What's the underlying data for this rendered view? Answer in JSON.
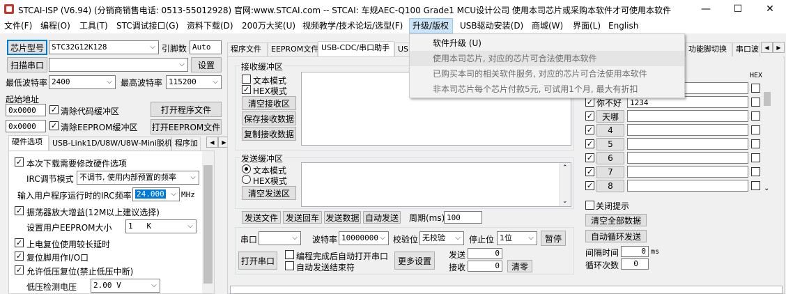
{
  "window": {
    "title": "STCAI-ISP (V6.94) (分销商销售电话: 0513-55012928) 官网:www.STCAI.com  -- STCAI: 车规AEC-Q100 Grade1 MCU设计公司 使用本司芯片或采购本软件才可使用本软件",
    "minimize": "—",
    "maximize": "☐",
    "close": "✕"
  },
  "menu": [
    "文件(F)",
    "编程(O)",
    "工具(T)",
    "STC调试接口(G)",
    "资料下载(D)",
    "200万大奖(U)",
    "视频教学/技术论坛/选型(F)",
    "升级/版权",
    "USB驱动安装(D)",
    "商城(W)",
    "界面(L)",
    "English"
  ],
  "dropdown": [
    "软件升级 (U)",
    "使用本司芯片, 对应的芯片可合法使用本软件",
    "已购买本司的相关软件服务, 对应的芯片可合法使用本软件",
    "非本司芯片每个芯片付款5元, 可试用1个月, 最大有折扣"
  ],
  "left": {
    "chip_type_btn": "芯片型号",
    "chip_model": "STC32G12K128",
    "pin_label": "引脚数",
    "pin_value": "Auto",
    "scan_port_btn": "扫描串口",
    "settings_btn": "设置",
    "min_baud_label": "最低波特率",
    "min_baud": "2400",
    "max_baud_label": "最高波特率",
    "max_baud": "115200",
    "start_addr_label": "起始地址",
    "addr1": "0x0000",
    "clear_code": "清除代码缓冲区",
    "open_prog_btn": "打开程序文件",
    "addr2": "0x0000",
    "clear_eeprom": "清除EEPROM缓冲区",
    "open_eeprom_btn": "打开EEPROM文件",
    "tabs": [
      "硬件选项",
      "USB-Link1D/U8W/U8W-Mini脱机",
      "程序加"
    ],
    "options": {
      "opt1": "本次下载需要修改硬件选项",
      "irc_mode_label": "IRC调节模式",
      "irc_mode": "不调节, 使用内部预置的频率",
      "irc_freq_label": "输入用户程序运行时的IRC频率",
      "irc_freq": "24.000",
      "mhz": "MHz",
      "opt2": "振荡器放大增益(12M以上建议选择)",
      "eeprom_size_label": "设置用户EEPROM大小",
      "eeprom_size": "1   K",
      "opt3": "上电复位使用较长延时",
      "opt4": "复位脚用作I/O口",
      "opt5": "允许低压复位(禁止低压中断)",
      "lv_label": "低压检测电压",
      "lv_value": "2.00 V"
    }
  },
  "right": {
    "tabs": [
      "程序文件",
      "EEPROM文件",
      "USB-CDC/串口助手",
      "USB"
    ],
    "tabs_right": [
      "功能脚切换",
      "串口波"
    ],
    "recv": {
      "title": "接收缓冲区",
      "text_mode": "文本模式",
      "hex_mode": "HEX模式",
      "clear_recv": "清空接收区",
      "save_recv": "保存接收数据",
      "copy_recv": "复制接收数据"
    },
    "send": {
      "title": "发送缓冲区",
      "text_mode": "文本模式",
      "hex_mode": "HEX模式",
      "clear_send": "清空发送区"
    },
    "buttons": [
      "发送文件",
      "发送回车",
      "发送数据",
      "自动发送"
    ],
    "period_label": "周期(ms)",
    "period": "100",
    "port_label": "串口",
    "baud_label": "波特率",
    "baud": "10000000",
    "parity_label": "校验位",
    "parity": "无校验",
    "stop_label": "停止位",
    "stop": "1位",
    "pause_btn": "暂停",
    "open_port_btn": "打开串口",
    "auto_open": "编程完成后自动打开串口",
    "auto_end": "自动发送结束符",
    "more_settings": "更多设置",
    "send_label": "发送",
    "send_count": "0",
    "recv_label": "接收",
    "recv_count": "0",
    "clear_btn": "清零"
  },
  "multi": {
    "hex": "HEX",
    "rows": [
      {
        "label": "你不好",
        "value": "1234",
        "is_button": false
      },
      {
        "label": "天哪",
        "value": "",
        "is_button": true
      },
      {
        "label": "4",
        "value": "",
        "is_button": true
      },
      {
        "label": "5",
        "value": "",
        "is_button": true
      },
      {
        "label": "6",
        "value": "",
        "is_button": true
      },
      {
        "label": "7",
        "value": "",
        "is_button": true
      },
      {
        "label": "8",
        "value": "",
        "is_button": true
      }
    ],
    "close_tip": "关闭提示",
    "clear_all": "清空全部数据",
    "auto_loop": "自动循环发送",
    "interval_label": "间隔时间",
    "interval": "0",
    "ms": "ms",
    "loop_label": "循环次数",
    "loop": "0"
  }
}
